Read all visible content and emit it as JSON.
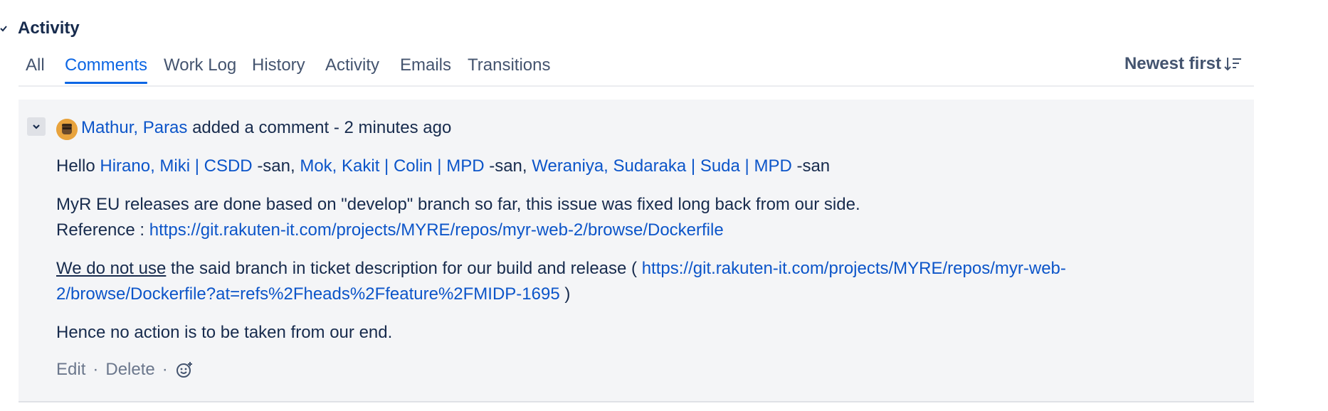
{
  "activity": {
    "title": "Activity",
    "tabs": [
      "All",
      "Comments",
      "Work Log",
      "History",
      "Activity",
      "Emails",
      "Transitions"
    ],
    "active_tab": "Comments",
    "sort_label": "Newest first"
  },
  "comment": {
    "author": "Mathur, Paras",
    "action": "added a comment - 2 minutes ago",
    "greeting": {
      "hello": "Hello",
      "mention1": "Hirano, Miki | CSDD",
      "suffix1": "-san,",
      "mention2": "Mok, Kakit | Colin | MPD",
      "suffix2": "-san,",
      "mention3": "Weraniya, Sudaraka | Suda | MPD",
      "suffix3": "-san"
    },
    "para2": {
      "line1": "MyR EU releases are done based on \"develop\" branch so far, this issue was fixed long back from our side.",
      "ref_label": "Reference :",
      "ref_link": "https://git.rakuten-it.com/projects/MYRE/repos/myr-web-2/browse/Dockerfile"
    },
    "para3": {
      "underlined": "We do not use",
      "text": "the said branch in ticket description for our build and release (",
      "link_part1": "https://git.rakuten-it.com/projects/MYRE/repos/myr-web-",
      "link_part2": "2/browse/Dockerfile?at=refs%2Fheads%2Ffeature%2FMIDP-1695",
      "close": ")"
    },
    "para4": "Hence no action is to be taken from our end.",
    "actions": {
      "edit": "Edit",
      "delete": "Delete",
      "separator": "·"
    }
  },
  "colors": {
    "link": "#0c55c9",
    "active_tab": "#0c66e4",
    "comment_bg": "#f4f5f7",
    "text": "#172b4d",
    "muted": "#6b778c"
  },
  "icons": [
    "chevron-down-icon",
    "sort-descending-icon",
    "user-avatar",
    "add-reaction-icon"
  ]
}
